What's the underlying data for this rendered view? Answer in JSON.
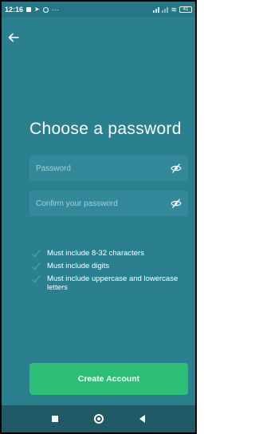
{
  "status_bar": {
    "time": "12:16",
    "overflow": "···",
    "battery": "41"
  },
  "header": {
    "back_icon": "arrow-left-icon"
  },
  "title": "Choose a password",
  "form": {
    "password_placeholder": "Password",
    "confirm_placeholder": "Confirm your password",
    "visibility_icon": "eye-off-icon"
  },
  "requirements": [
    "Must include 8-32 characters",
    "Must include digits",
    "Must include uppercase and lowercase letters"
  ],
  "create_button_label": "Create Account",
  "colors": {
    "background": "#2b8090",
    "field": "#33899a",
    "button": "#2dbf75",
    "navbar": "#1f5a66"
  }
}
